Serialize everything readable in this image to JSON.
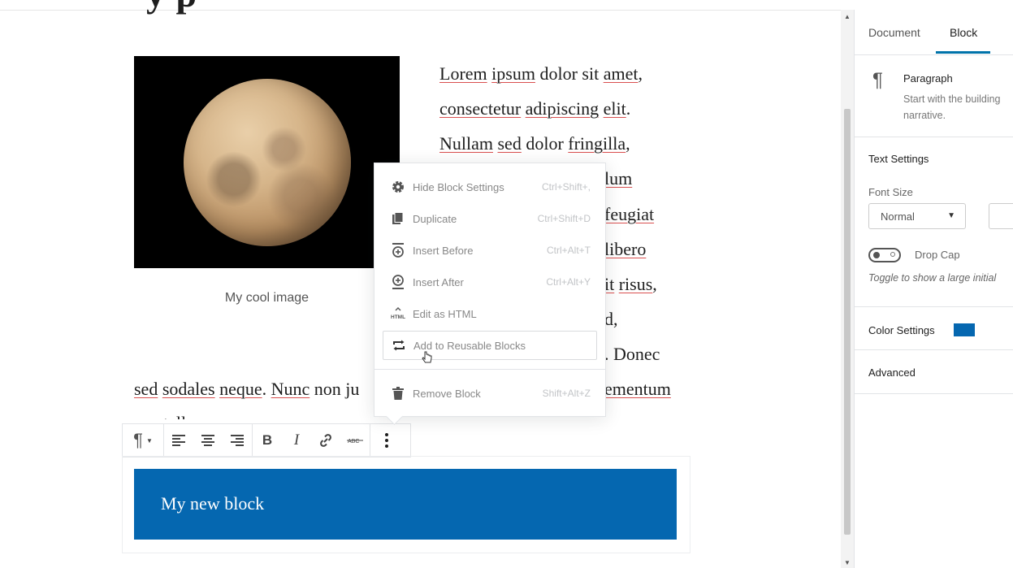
{
  "page": {
    "title_fragment": "y  p"
  },
  "image_block": {
    "caption": "My cool image"
  },
  "paragraph": {
    "line1": [
      "Lorem",
      "ipsum",
      "dolor sit",
      "amet",
      ","
    ],
    "line2": [
      "consectetur",
      "adipiscing",
      "elit",
      "."
    ],
    "line3": [
      "Nullam",
      "sed",
      "dolor",
      "fringilla",
      ","
    ],
    "line4_tail": "lum",
    "line5_tail": "feugiat",
    "line6_tail": "libero",
    "line7_tail": "it",
    "line7_tail2": "risus",
    "line7_tail3": ",",
    "line8_tail": "d,",
    "line9_tail": ". Donec",
    "line10": [
      "sed",
      "sodales",
      "neque",
      ". ",
      "Nunc",
      " non ju"
    ],
    "line10_tail": "ementum",
    "line11": "nec tellus"
  },
  "block_toolbar": {
    "icons": [
      "paragraph-icon",
      "align-left-icon",
      "align-center-icon",
      "align-right-icon",
      "bold-icon",
      "italic-icon",
      "link-icon",
      "strikethrough-icon",
      "more-options-icon"
    ],
    "bold": "B",
    "italic": "I"
  },
  "new_block": {
    "text": "My new block",
    "bg_color": "#0567b0"
  },
  "menu": {
    "items": [
      {
        "label": "Hide Block Settings",
        "shortcut": "Ctrl+Shift+,",
        "icon": "gear-icon"
      },
      {
        "label": "Duplicate",
        "shortcut": "Ctrl+Shift+D",
        "icon": "duplicate-icon"
      },
      {
        "label": "Insert Before",
        "shortcut": "Ctrl+Alt+T",
        "icon": "insert-before-icon"
      },
      {
        "label": "Insert After",
        "shortcut": "Ctrl+Alt+Y",
        "icon": "insert-after-icon"
      },
      {
        "label": "Edit as HTML",
        "shortcut": "",
        "icon": "html-icon"
      },
      {
        "label": "Add to Reusable Blocks",
        "shortcut": "",
        "icon": "reusable-icon"
      },
      {
        "label": "Remove Block",
        "shortcut": "Shift+Alt+Z",
        "icon": "trash-icon"
      }
    ]
  },
  "sidebar": {
    "tabs": [
      "Document",
      "Block"
    ],
    "selected_tab": "Block",
    "block_card": {
      "name": "Paragraph",
      "desc_line1": "Start with the building",
      "desc_line2": "narrative."
    },
    "text_settings": {
      "title": "Text Settings",
      "font_size_label": "Font Size",
      "font_size_value": "Normal",
      "drop_cap_label": "Drop Cap",
      "drop_cap_help": "Toggle to show a large initial"
    },
    "color_settings": {
      "title": "Color Settings",
      "swatch_color": "#0567b0"
    },
    "advanced": {
      "title": "Advanced"
    }
  }
}
